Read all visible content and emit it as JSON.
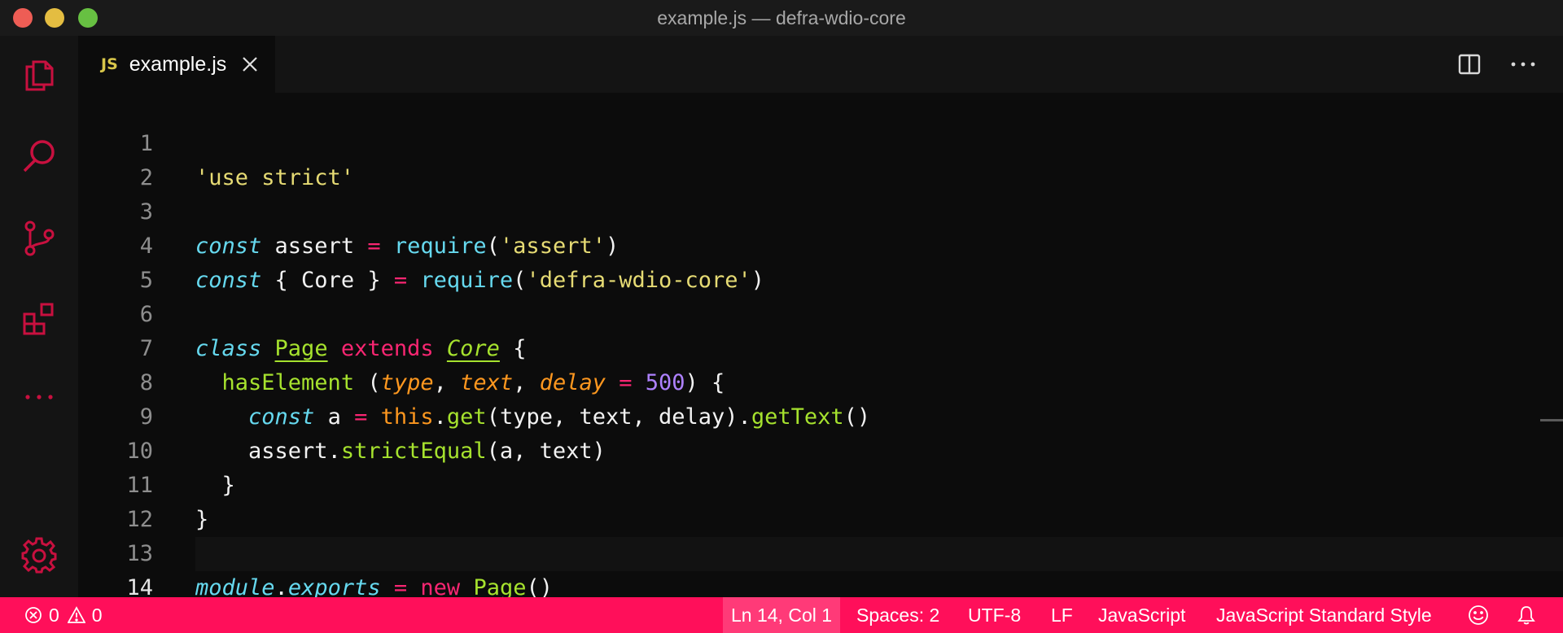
{
  "window": {
    "title": "example.js — defra-wdio-core"
  },
  "activity_bar": {
    "items": [
      "files-icon",
      "search-icon",
      "source-control-icon",
      "extensions-icon",
      "more-icon",
      "settings-icon"
    ]
  },
  "tabs": [
    {
      "type_badge": "JS",
      "label": "example.js",
      "active": true
    }
  ],
  "editor": {
    "line_numbers": [
      "1",
      "2",
      "3",
      "4",
      "5",
      "6",
      "7",
      "8",
      "9",
      "10",
      "11",
      "12",
      "13",
      "14"
    ],
    "current_line": 14,
    "lines": {
      "l1": {
        "str": "'use strict'"
      },
      "l3": {
        "kw": "const",
        "name": " assert ",
        "op": "=",
        "fn": "require",
        "p1": "(",
        "str": "'assert'",
        "p2": ")"
      },
      "l4": {
        "kw": "const",
        "name": " { Core } ",
        "op": "=",
        "fn": "require",
        "p1": "(",
        "str": "'defra-wdio-core'",
        "p2": ")"
      },
      "l6": {
        "kw": "class",
        "cls": "Page",
        "ext": "extends",
        "base": "Core",
        "brace": " {"
      },
      "l7": {
        "fn": "hasElement",
        "p1": " (",
        "a1": "type",
        "c1": ", ",
        "a2": "text",
        "c2": ", ",
        "a3": "delay",
        "eq": " = ",
        "num": "500",
        "p2": ") {"
      },
      "l8": {
        "kw": "const",
        "name": " a ",
        "op": "=",
        "this": "this",
        "dot": ".",
        "get": "get",
        "args": "(type, text, delay).",
        "gettext": "getText",
        "end": "()"
      },
      "l9": {
        "obj": "assert.",
        "fn": "strictEqual",
        "args": "(a, text)"
      },
      "l10": {
        "text": "}"
      },
      "l11": {
        "text": "}"
      },
      "l13": {
        "mod": "module",
        "dot": ".",
        "exp": "exports",
        "op": " = ",
        "nw": "new",
        "cls": "Page",
        "end": "()"
      }
    }
  },
  "status_bar": {
    "errors": "0",
    "warnings": "0",
    "position": "Ln 14, Col 1",
    "spaces": "Spaces: 2",
    "encoding": "UTF-8",
    "eol": "LF",
    "language": "JavaScript",
    "linter": "JavaScript Standard Style"
  },
  "colors": {
    "accent": "#ff0f5a",
    "icon": "#c8103f",
    "string": "#e6db74",
    "keyword": "#66d9ef",
    "operator": "#f92672",
    "function": "#a6e22e",
    "number": "#ae81ff",
    "param": "#fd971f"
  }
}
